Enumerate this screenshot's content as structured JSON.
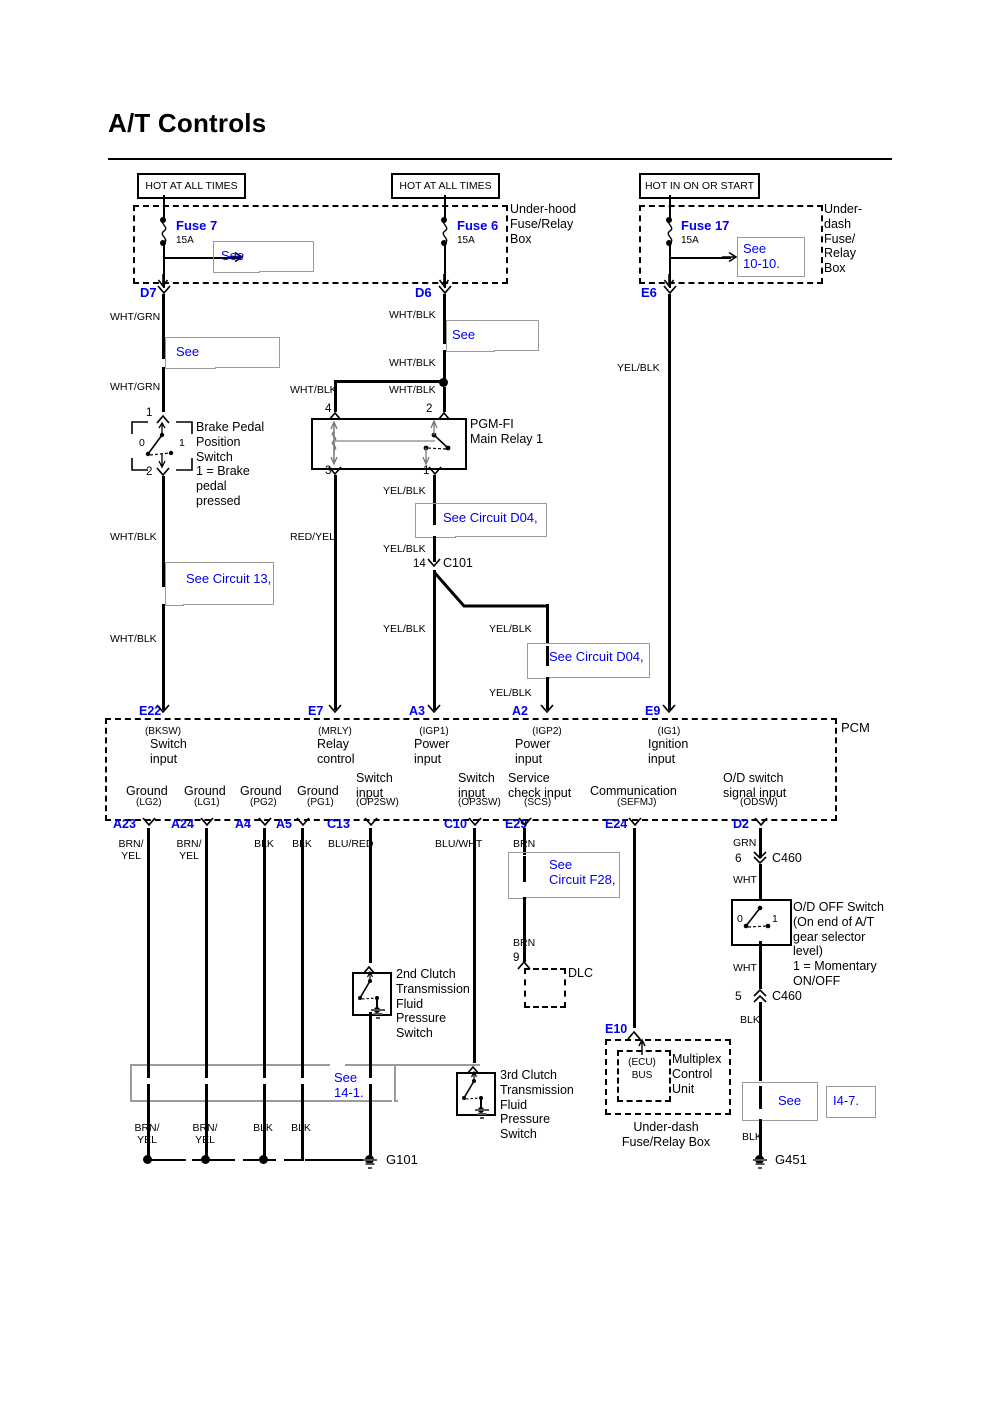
{
  "page": {
    "title": "A/T Controls"
  },
  "power_sources": [
    {
      "id": "hot-1",
      "label": "HOT AT ALL TIMES"
    },
    {
      "id": "hot-2",
      "label": "HOT AT ALL TIMES"
    },
    {
      "id": "hot-3",
      "label": "HOT IN ON OR START"
    }
  ],
  "boxes": {
    "underhood": "Under-hood\nFuse/Relay\nBox",
    "underdash": "Under-\ndash\nFuse/\nRelay\nBox",
    "underdash_bottom": "Under-dash\nFuse/Relay Box",
    "pcm": "PCM"
  },
  "fuses": [
    {
      "name": "Fuse 7",
      "rating": "15A",
      "terminal": "D7"
    },
    {
      "name": "Fuse 6",
      "rating": "15A",
      "terminal": "D6"
    },
    {
      "name": "Fuse 17",
      "rating": "15A",
      "terminal": "E6"
    }
  ],
  "references": [
    {
      "id": "ref-fuse7",
      "text": "See"
    },
    {
      "id": "ref-fuse17",
      "text": "See\n10-10."
    },
    {
      "id": "ref-whtgrn",
      "text": "See"
    },
    {
      "id": "ref-whtblk-d6",
      "text": "See"
    },
    {
      "id": "ref-circuit-13",
      "text": "See Circuit 13,"
    },
    {
      "id": "ref-circuit-d04-a",
      "text": "See Circuit D04,"
    },
    {
      "id": "ref-circuit-d04-b",
      "text": "See Circuit D04,"
    },
    {
      "id": "ref-circuit-f28",
      "text": "See\nCircuit F28,"
    },
    {
      "id": "ref-14-1",
      "text": "See\n14-1."
    },
    {
      "id": "ref-g451-see",
      "text": "See"
    },
    {
      "id": "ref-g451-num",
      "text": "I4-7."
    }
  ],
  "components": {
    "brake_switch": {
      "label": "Brake Pedal\nPosition\nSwitch\n1 = Brake\n    pedal\n    pressed",
      "pin_top": "1",
      "pin_bottom": "2",
      "pos_0": "0",
      "pos_1": "1"
    },
    "main_relay": {
      "label": "PGM-FI\nMain Relay 1",
      "pin_4": "4",
      "pin_2": "2",
      "pin_3": "3",
      "pin_1": "1"
    },
    "clutch2": {
      "label": "2nd Clutch\nTransmission\nFluid\nPressure\nSwitch"
    },
    "clutch3": {
      "label": "3rd Clutch\nTransmission\nFluid\nPressure\nSwitch"
    },
    "od_switch": {
      "label": "O/D OFF Switch\n(On end of A/T\ngear selector\nlevel)\n1 = Momentary\n      ON/OFF",
      "pos_0": "0",
      "pos_1": "1"
    },
    "dlc": {
      "label": "DLC",
      "pin": "9"
    },
    "multiplex": {
      "label": "Multiplex\nControl\nUnit",
      "bus": "(ECU)\nBUS",
      "terminal": "E10"
    },
    "c101": {
      "label": "C101",
      "pin": "14"
    },
    "c460_top": {
      "label": "C460",
      "pin": "6"
    },
    "c460_bottom": {
      "label": "C460",
      "pin": "5"
    }
  },
  "pcm_top_terminals": [
    {
      "id": "E22",
      "code": "(BKSW)",
      "desc": "Switch\ninput"
    },
    {
      "id": "E7",
      "code": "(MRLY)",
      "desc": "Relay\ncontrol"
    },
    {
      "id": "A3",
      "code": "(IGP1)",
      "desc": "Power\ninput"
    },
    {
      "id": "A2",
      "code": "(IGP2)",
      "desc": "Power\ninput"
    },
    {
      "id": "E9",
      "code": "(IG1)",
      "desc": "Ignition\ninput"
    }
  ],
  "pcm_bottom_terminals": [
    {
      "id": "A23",
      "code": "(LG2)",
      "desc": "Ground",
      "wire": "BRN/\nYEL"
    },
    {
      "id": "A24",
      "code": "(LG1)",
      "desc": "Ground",
      "wire": "BRN/\nYEL"
    },
    {
      "id": "A4",
      "code": "(PG2)",
      "desc": "Ground",
      "wire": "BLK"
    },
    {
      "id": "A5",
      "code": "(PG1)",
      "desc": "Ground",
      "wire": "BLK"
    },
    {
      "id": "C13",
      "code": "(OP2SW)",
      "desc": "Switch\ninput",
      "wire": "BLU/RED"
    },
    {
      "id": "C10",
      "code": "(OP3SW)",
      "desc": "Switch\ninput",
      "wire": "BLU/WHT"
    },
    {
      "id": "E29",
      "code": "(SCS)",
      "desc": "Service\ncheck input",
      "wire": "BRN"
    },
    {
      "id": "E24",
      "code": "(SEFMJ)",
      "desc": "Communication",
      "wire": ""
    },
    {
      "id": "D2",
      "code": "(ODSW)",
      "desc": "O/D switch\nsignal input",
      "wire": "GRN"
    }
  ],
  "wire_labels": {
    "d7_a": "WHT/GRN",
    "d7_b": "WHT/GRN",
    "bps_out_a": "WHT/BLK",
    "bps_out_b": "WHT/BLK",
    "d6_a": "WHT/BLK",
    "d6_b": "WHT/BLK",
    "d6_c": "WHT/BLK",
    "relay4": "WHT/BLK",
    "relay2": "WHT/BLK",
    "relay3": "RED/YEL",
    "relay1": "YEL/BLK",
    "c101_in": "YEL/BLK",
    "a3_down": "YEL/BLK",
    "a2_branch": "YEL/BLK",
    "a2_down": "YEL/BLK",
    "e6": "YEL/BLK",
    "od_wht_top": "WHT",
    "od_wht_bot": "WHT",
    "od_blk": "BLK",
    "od_blk_g451": "BLK",
    "dlc_brn": "BRN",
    "g101_wires": [
      "BRN/\nYEL",
      "BRN/\nYEL",
      "BLK",
      "BLK"
    ]
  },
  "grounds": [
    {
      "id": "G101",
      "label": "G101"
    },
    {
      "id": "G451",
      "label": "G451"
    }
  ],
  "colors": {
    "wire": "#000000",
    "reference_text": "#0000ee",
    "refbox_border": "#9b9b9b"
  }
}
